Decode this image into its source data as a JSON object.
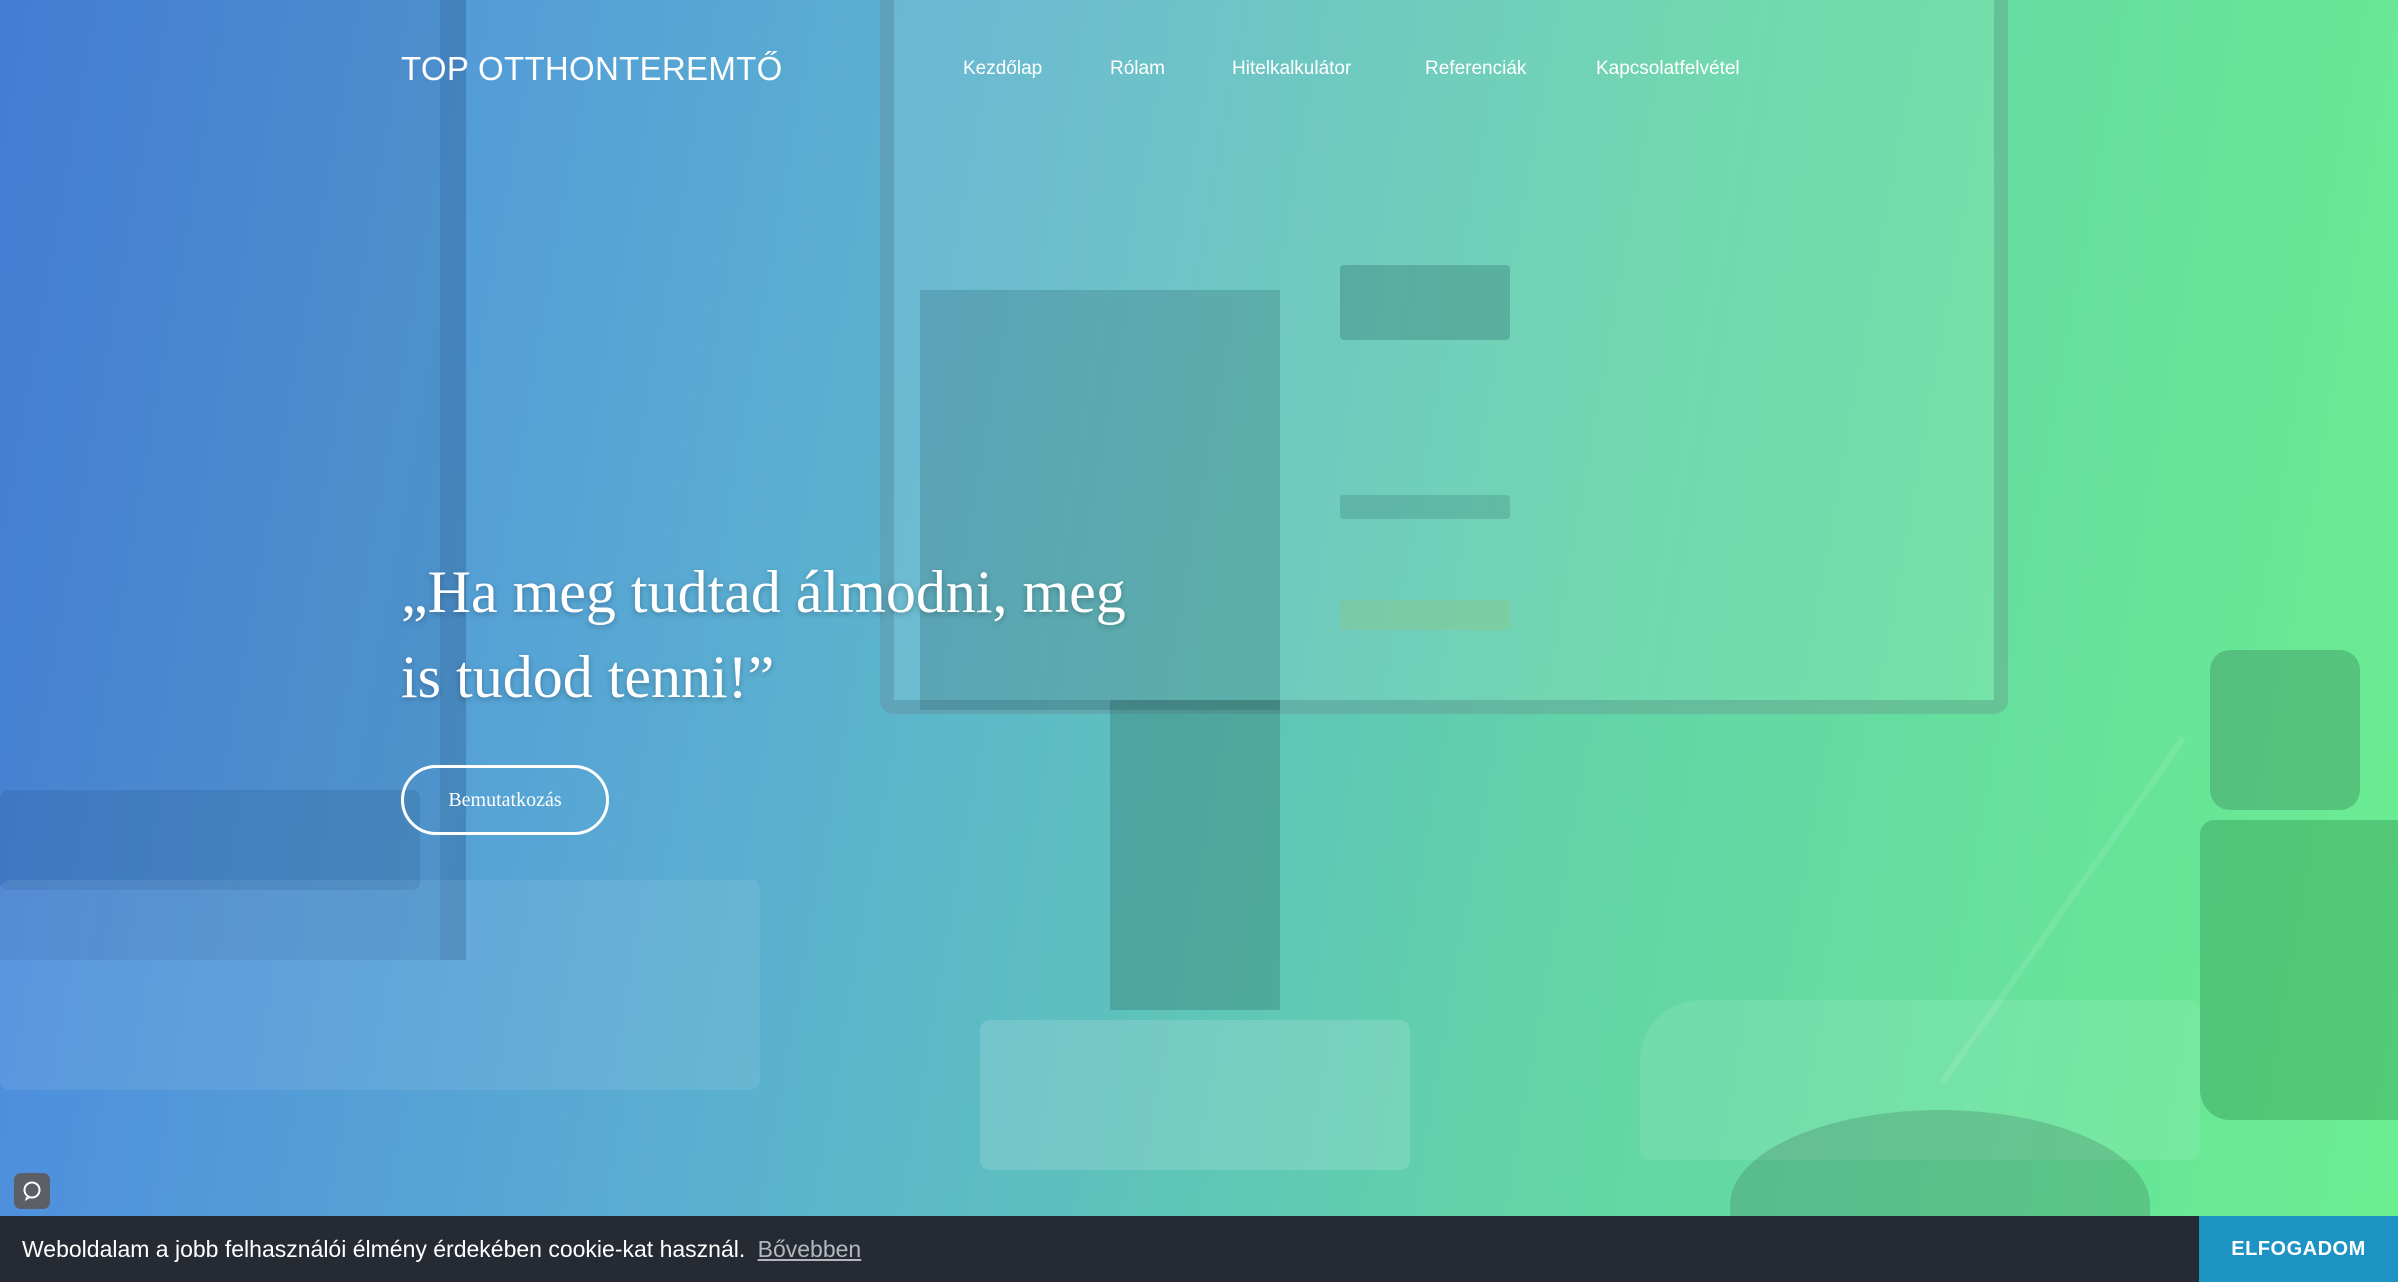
{
  "brand": {
    "logo_text": "TOP OTTHONTEREMTŐ"
  },
  "nav": {
    "items": [
      {
        "label": "Kezdőlap"
      },
      {
        "label": "Rólam"
      },
      {
        "label": "Hitelkalkulátor"
      },
      {
        "label": "Referenciák"
      },
      {
        "label": "Kapcsolatfelvétel"
      }
    ]
  },
  "hero": {
    "quote_line1": "„Ha meg tudtad álmodni, meg",
    "quote_line2": "is tudod tenni!”",
    "cta_label": "Bemutatkozás",
    "gradient_colors": [
      "#4a86e0",
      "#6bee90"
    ]
  },
  "chat_widget": {
    "icon": "chat-bubble-icon"
  },
  "cookie_bar": {
    "message": "Weboldalam a jobb felhasználói élmény érdekében cookie-kat használ.",
    "more_link": "Bővebben",
    "accept_label": "ELFOGADOM",
    "bar_color": "#252a33",
    "accept_color": "#1d93c4"
  }
}
